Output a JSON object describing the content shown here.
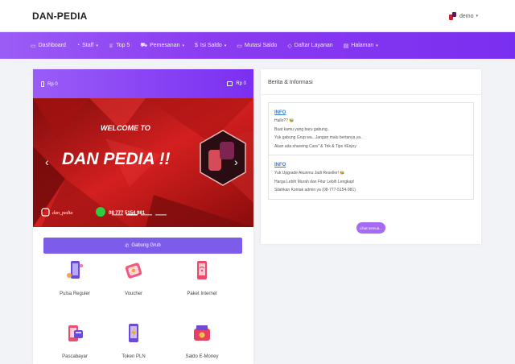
{
  "header": {
    "brand": "DAN-PEDIA",
    "user": "demo",
    "user_caret": "▾"
  },
  "nav": [
    {
      "icon": "monitor",
      "label": "Dashboard",
      "caret": ""
    },
    {
      "icon": "bag",
      "label": "Staff",
      "caret": "▾"
    },
    {
      "icon": "trophy",
      "label": "Top 5",
      "caret": ""
    },
    {
      "icon": "cart",
      "label": "Pemesanan",
      "caret": "▾"
    },
    {
      "icon": "dollar",
      "label": "Isi Saldo",
      "caret": "▾"
    },
    {
      "icon": "monitor",
      "label": "Mutasi Saldo",
      "caret": ""
    },
    {
      "icon": "tag",
      "label": "Daftar Layanan",
      "caret": ""
    },
    {
      "icon": "book",
      "label": "Halaman",
      "caret": "▾"
    }
  ],
  "balance": {
    "left": "Rp 0",
    "right": "Rp 0"
  },
  "banner": {
    "welcome": "WELCOME TO",
    "title": "DAN PEDIA !!",
    "ig": "dan_pedia",
    "phone": "08 777 5154 981",
    "prev": "‹",
    "next": "›"
  },
  "join_button": "Gabung Grub",
  "services": [
    {
      "label": "Pulsa Reguler",
      "icon": "phone-pulsa-icon"
    },
    {
      "label": "Voucher",
      "icon": "voucher-icon"
    },
    {
      "label": "Paket Internet",
      "icon": "internet-package-icon"
    },
    {
      "label": "Pascabayar",
      "icon": "postpaid-icon"
    },
    {
      "label": "Token PLN",
      "icon": "pln-token-icon"
    },
    {
      "label": "Saldo E-Money",
      "icon": "emoney-icon"
    }
  ],
  "news": {
    "title": "Berita & Informasi",
    "items": [
      {
        "tag": "INFO",
        "lines": [
          "Hallo?? 🐝",
          "Buat kamu yang baru gabung..",
          "Yuk gabung Grup wa...Jangan malu bertanya ya..",
          "Akan ada shareing Cara\" & Trik & Tips #Enjoy"
        ]
      },
      {
        "tag": "INFO",
        "lines": [
          "Yuk Upgrade Akunmu Jadi Reseller! 🐝",
          "Harga Lebih Murah dan Fitur Lebih Lengkap!",
          "Silahkan Kontak admin ya (08-777-5154-981)"
        ]
      }
    ],
    "see_all": "Lihat semua..."
  },
  "colors": {
    "accent": "#7a2ff0",
    "button": "#7c5ce8",
    "banner_red": "#c81818"
  }
}
